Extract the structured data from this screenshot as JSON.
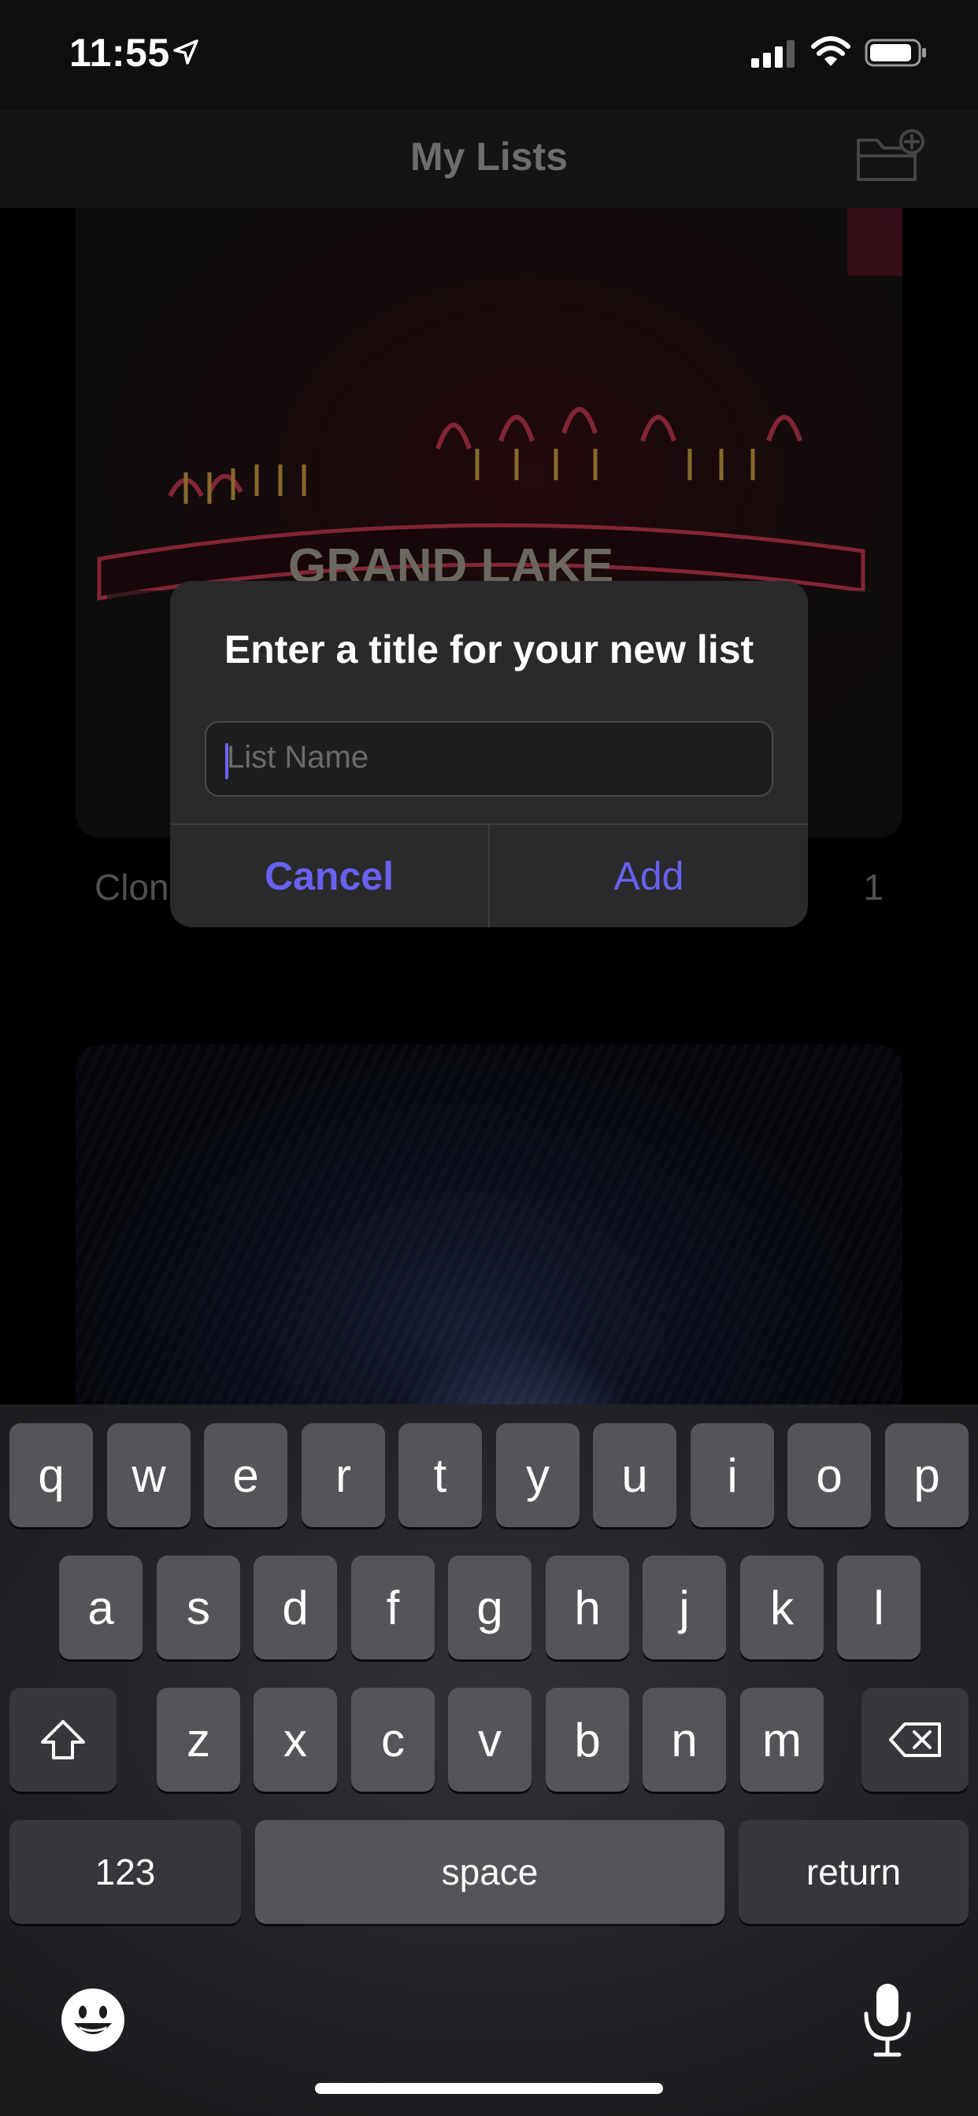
{
  "status_bar": {
    "time": "11:55",
    "icons": [
      "location-arrow-icon",
      "cellular-signal-icon",
      "wifi-icon",
      "battery-icon"
    ]
  },
  "nav": {
    "title": "My Lists",
    "action_icon": "new-folder-icon"
  },
  "lists": [
    {
      "title": "Clon",
      "count": "1",
      "thumbnail": "neon theater marquee"
    },
    {
      "title": "",
      "count": "",
      "thumbnail": "blue forest"
    }
  ],
  "marquee_text": "GRAND LAKE",
  "alert": {
    "title": "Enter a title for your new list",
    "input_placeholder": "List Name",
    "input_value": "",
    "cancel_label": "Cancel",
    "add_label": "Add"
  },
  "keyboard": {
    "row1": [
      "q",
      "w",
      "e",
      "r",
      "t",
      "y",
      "u",
      "i",
      "o",
      "p"
    ],
    "row2": [
      "a",
      "s",
      "d",
      "f",
      "g",
      "h",
      "j",
      "k",
      "l"
    ],
    "row3": [
      "z",
      "x",
      "c",
      "v",
      "b",
      "n",
      "m"
    ],
    "numbers_label": "123",
    "space_label": "space",
    "return_label": "return",
    "shift_icon": "shift-icon",
    "delete_icon": "delete-icon",
    "emoji_icon": "emoji-icon",
    "mic_icon": "microphone-icon"
  },
  "colors": {
    "accent": "#6861f0",
    "alert_bg": "#2a2a2c",
    "key_bg": "#545558"
  }
}
